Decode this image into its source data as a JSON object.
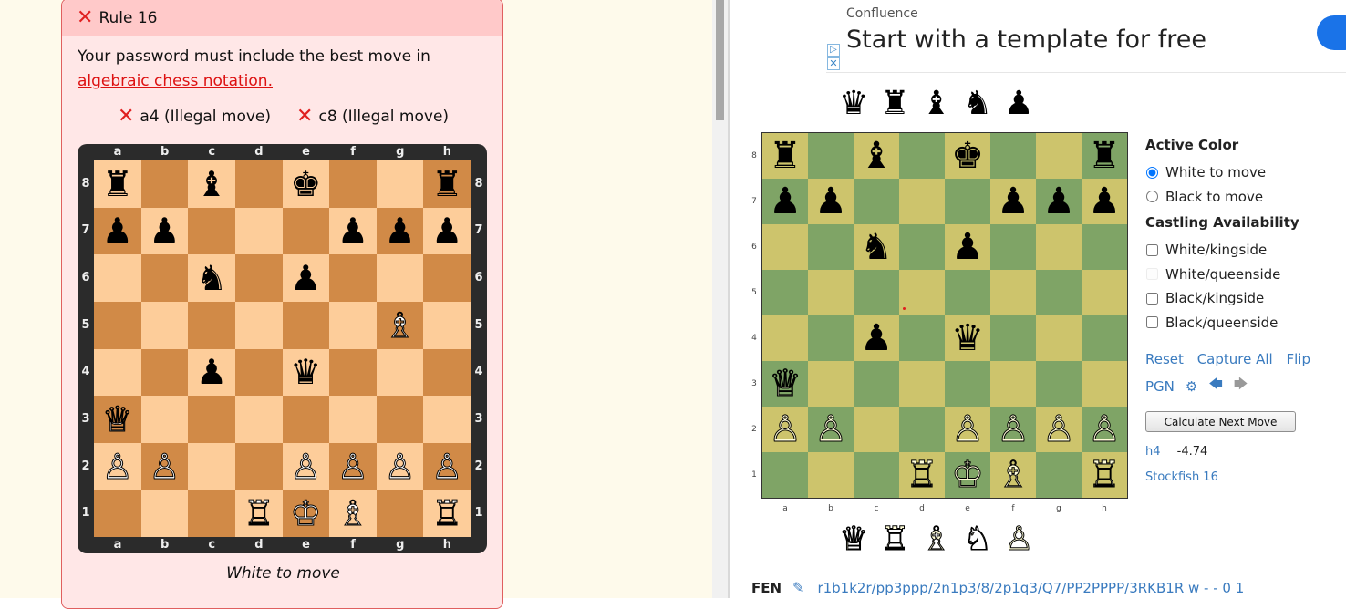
{
  "rule": {
    "title": "Rule 16",
    "text": "Your password must include the best move in ",
    "link_text": "algebraic chess notation.",
    "attempts": [
      {
        "move": "a4",
        "status": "(Illegal move)"
      },
      {
        "move": "c8",
        "status": "(Illegal move)"
      }
    ],
    "caption": "White to move"
  },
  "board_files": [
    "a",
    "b",
    "c",
    "d",
    "e",
    "f",
    "g",
    "h"
  ],
  "board_ranks": [
    "8",
    "7",
    "6",
    "5",
    "4",
    "3",
    "2",
    "1"
  ],
  "position": [
    [
      "♜",
      "",
      "♝",
      "",
      "♚",
      "",
      "",
      "♜"
    ],
    [
      "♟",
      "♟",
      "",
      "",
      "",
      "♟",
      "♟",
      "♟"
    ],
    [
      "",
      "",
      "♞",
      "",
      "♟",
      "",
      "",
      ""
    ],
    [
      "",
      "",
      "",
      "",
      "",
      "",
      "♗",
      ""
    ],
    [
      "",
      "",
      "♟",
      "",
      "♛",
      "",
      "",
      ""
    ],
    [
      "♕",
      "",
      "",
      "",
      "",
      "",
      "",
      ""
    ],
    [
      "♙",
      "♙",
      "",
      "",
      "♙",
      "♙",
      "♙",
      "♙"
    ],
    [
      "",
      "",
      "",
      "♖",
      "♔",
      "♗",
      "",
      "♖"
    ]
  ],
  "editor_position": [
    [
      "♜",
      "",
      "♝",
      "",
      "♚",
      "",
      "",
      "♜"
    ],
    [
      "♟",
      "♟",
      "",
      "",
      "",
      "♟",
      "♟",
      "♟"
    ],
    [
      "",
      "",
      "♞",
      "",
      "♟",
      "",
      "",
      ""
    ],
    [
      "",
      "",
      "",
      "",
      "",
      "",
      "",
      ""
    ],
    [
      "",
      "",
      "♟",
      "",
      "♛",
      "",
      "",
      ""
    ],
    [
      "♕",
      "",
      "",
      "",
      "",
      "",
      "",
      ""
    ],
    [
      "♙",
      "♙",
      "",
      "",
      "♙",
      "♙",
      "♙",
      "♙"
    ],
    [
      "",
      "",
      "",
      "♖",
      "♔",
      "♗",
      "",
      "♖"
    ]
  ],
  "ad": {
    "brand": "Confluence",
    "headline": "Start with a template for free"
  },
  "captured_black": [
    "♛",
    "♜",
    "♝",
    "♞",
    "♟"
  ],
  "captured_white": [
    "♕",
    "♖",
    "♗",
    "♘",
    "♙"
  ],
  "editor": {
    "active_color_title": "Active Color",
    "white_to_move": "White to move",
    "black_to_move": "Black to move",
    "castling_title": "Castling Availability",
    "castling": [
      {
        "label": "White/kingside",
        "disabled": false
      },
      {
        "label": "White/queenside",
        "disabled": true
      },
      {
        "label": "Black/kingside",
        "disabled": false
      },
      {
        "label": "Black/queenside",
        "disabled": false
      }
    ],
    "reset": "Reset",
    "capture_all": "Capture All",
    "flip": "Flip",
    "pgn": "PGN",
    "calc_button": "Calculate Next Move",
    "engine_move": "h4",
    "engine_score": "-4.74",
    "engine_name": "Stockfish 16"
  },
  "fen": {
    "label": "FEN",
    "value": "r1b1k2r/pp3ppp/2n1p3/8/2p1q3/Q7/PP2PPPP/3RKB1R w - - 0 1"
  },
  "colors": {
    "board1_light": "#fdcd9a",
    "board1_dark": "#d18a47",
    "board2_light": "#cdc46c",
    "board2_dark": "#7fa466",
    "error_red": "#e01f1f",
    "link_blue": "#3a7bbf"
  }
}
